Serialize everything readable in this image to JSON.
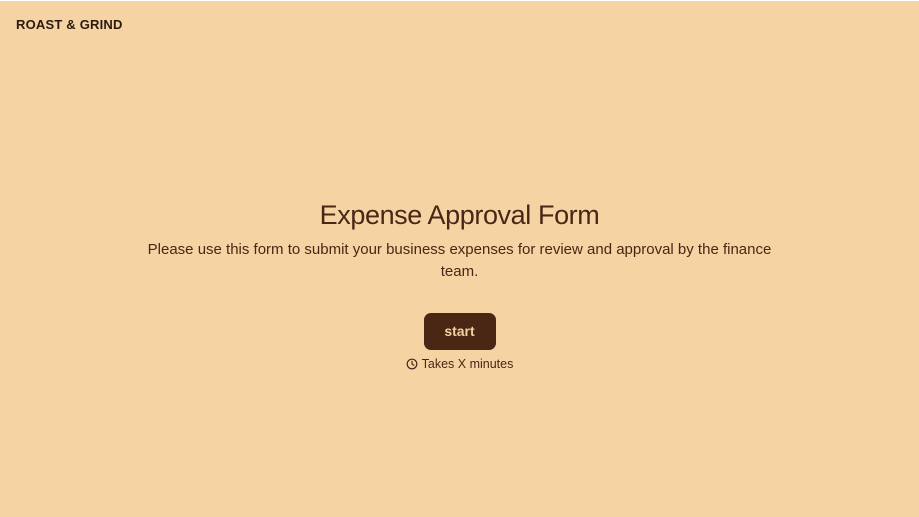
{
  "brand": {
    "name": "ROAST & GRIND"
  },
  "welcome": {
    "title": "Expense Approval Form",
    "description": "Please use this form to submit your business expenses for review and approval by the finance team.",
    "start_label": "start",
    "time_text": "Takes X minutes",
    "time_icon": "clock-icon"
  },
  "colors": {
    "background": "#f5d3a2",
    "text": "#4a2616",
    "button_bg": "#4a2614",
    "button_text": "#f3d3a2"
  }
}
